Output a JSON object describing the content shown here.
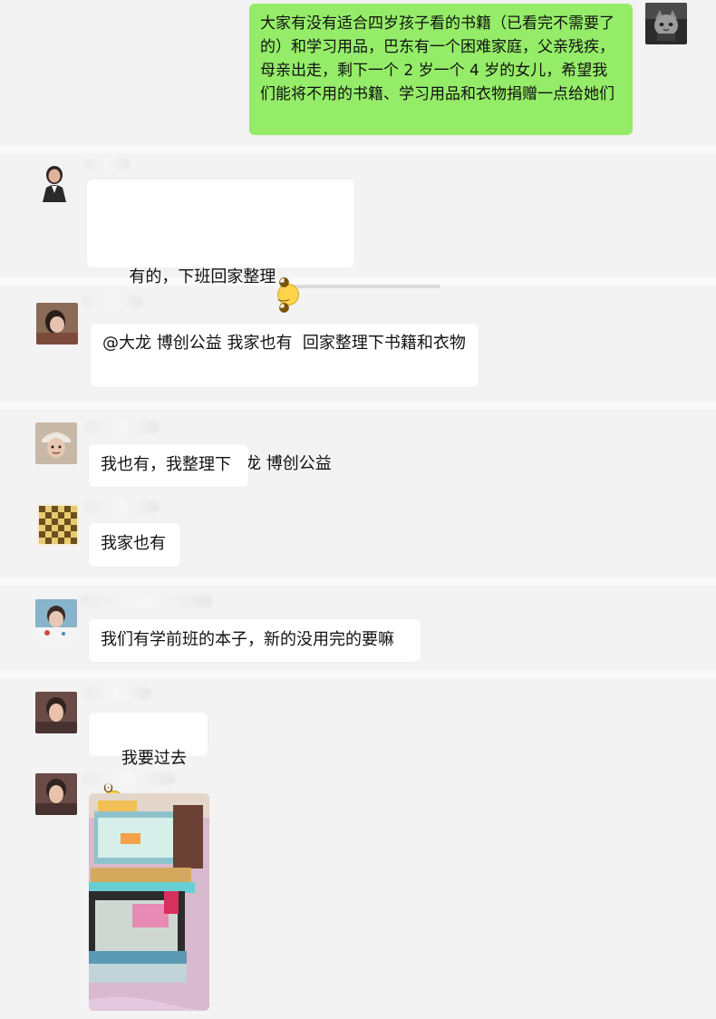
{
  "colors": {
    "background": "#ebebeb",
    "panel": "#f3f3f3",
    "right_bubble": "#95ec69",
    "left_bubble": "#ffffff"
  },
  "messages": [
    {
      "id": "outgoing-request",
      "side": "right",
      "text": "大家有没有适合四岁孩子看的书籍（已看完不需要了的）和学习用品，巴东有一个困难家庭，父亲残疾，母亲出走，剩下一个 2 岁一个 4 岁的女儿，希望我们能将不用的书籍、学习用品和衣物捐赠一点给她们"
    },
    {
      "id": "reply-1",
      "side": "left",
      "text_line_1": "有的，下班回家整理",
      "text_line_2": "整理好了艾特你@大龙 博创公益"
    },
    {
      "id": "reply-2",
      "side": "left",
      "text": "@大龙 博创公益 我家也有  回家整理下书籍和衣物"
    },
    {
      "id": "reply-3",
      "side": "left",
      "text": "我也有，我整理下"
    },
    {
      "id": "reply-4",
      "side": "left",
      "text": "我家也有"
    },
    {
      "id": "reply-5",
      "side": "left",
      "text": "我们有学前班的本子，新的没用完的要嘛"
    },
    {
      "id": "reply-6",
      "side": "left",
      "text": "我要过去"
    },
    {
      "id": "reply-7",
      "side": "left",
      "kind": "image"
    }
  ],
  "icons": {
    "smile": "slightly-smiling-face-icon",
    "grin": "grinning-face-icon"
  }
}
